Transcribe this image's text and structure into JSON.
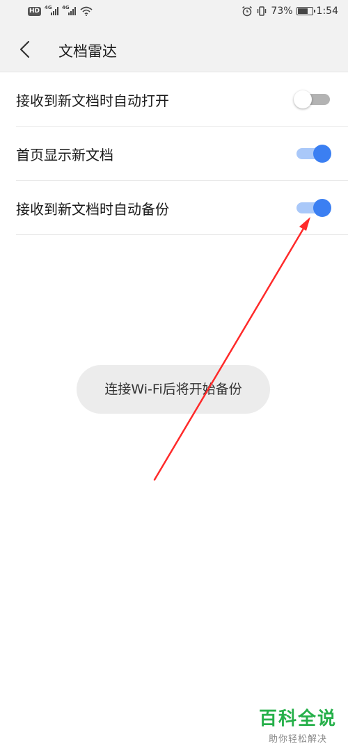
{
  "status_bar": {
    "hd_label": "HD",
    "network_1": "4G",
    "network_2": "4G",
    "battery_percent": "73%",
    "battery_level": 0.73,
    "time": "1:54",
    "icons": [
      "wifi-icon",
      "alarm-icon",
      "vibrate-icon",
      "battery-icon"
    ]
  },
  "header": {
    "title": "文档雷达",
    "back_icon": "chevron-left-icon"
  },
  "settings": [
    {
      "label": "接收到新文档时自动打开",
      "enabled": false
    },
    {
      "label": "首页显示新文档",
      "enabled": true
    },
    {
      "label": "接收到新文档时自动备份",
      "enabled": true
    }
  ],
  "toast": {
    "message": "连接Wi-Fi后将开始备份"
  },
  "colors": {
    "toggle_on_thumb": "#3b7ff2",
    "toggle_on_track": "#a9c8f9",
    "toggle_off_track": "#b3b3b3",
    "annotation_arrow": "#ff2a2a",
    "watermark": "#26b04a"
  },
  "watermark": {
    "title": "百科全说",
    "subtitle": "助你轻松解决"
  }
}
